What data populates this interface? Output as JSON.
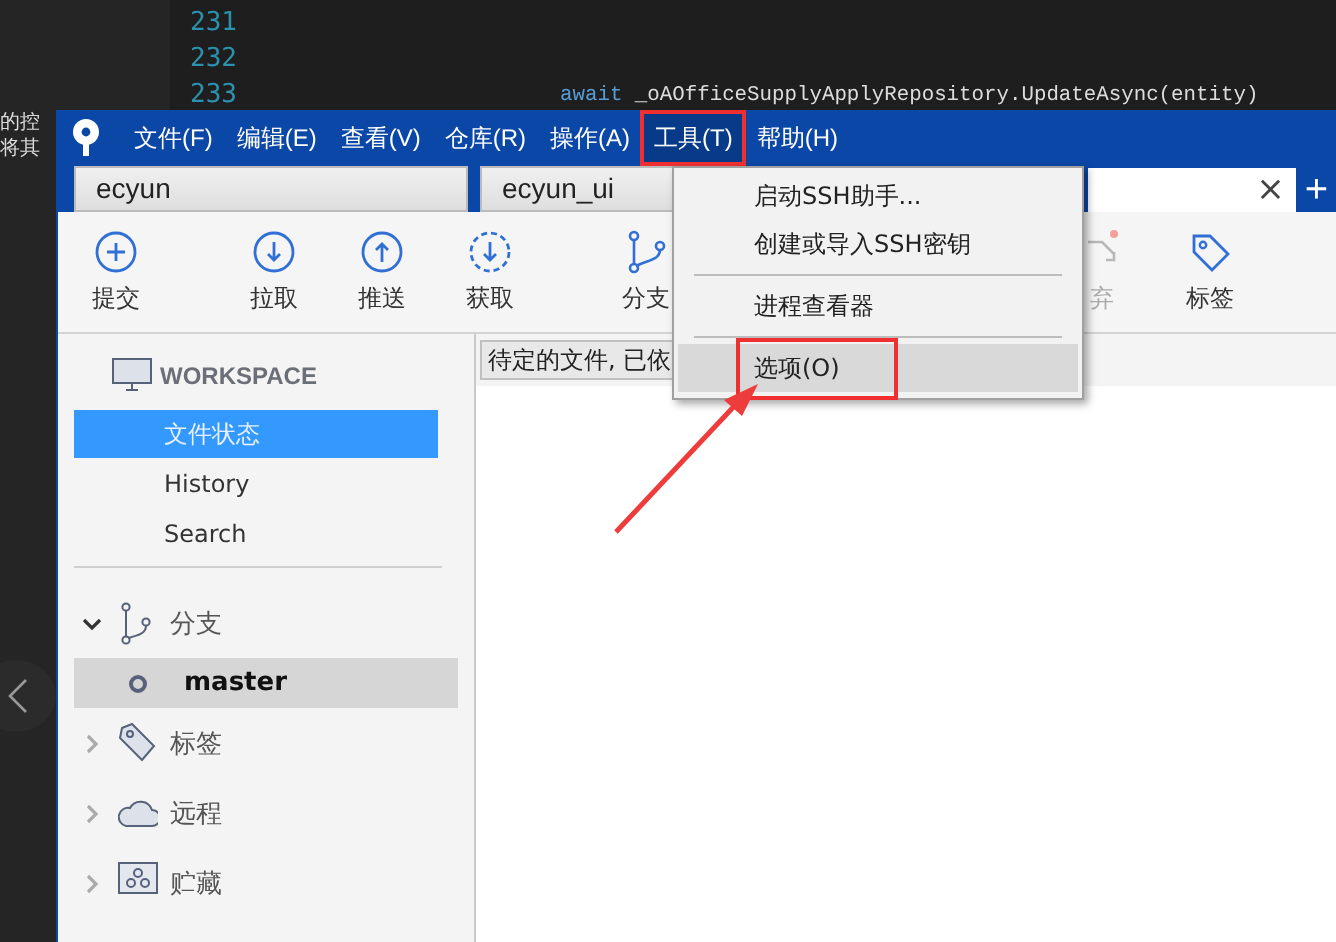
{
  "editor": {
    "side_texts": [
      "的控",
      "将其"
    ],
    "line_numbers": [
      "231",
      "232",
      "233"
    ],
    "code_line": {
      "keyword": "await",
      "rest": "_oAOfficeSupplyApplyRepository.UpdateAsync(entity)"
    }
  },
  "window": {
    "menu": [
      {
        "label": "文件(F)",
        "selected": false,
        "annotated": false
      },
      {
        "label": "编辑(E)",
        "selected": false,
        "annotated": false
      },
      {
        "label": "查看(V)",
        "selected": false,
        "annotated": false
      },
      {
        "label": "仓库(R)",
        "selected": false,
        "annotated": false
      },
      {
        "label": "操作(A)",
        "selected": false,
        "annotated": false
      },
      {
        "label": "工具(T)",
        "selected": true,
        "annotated": true
      },
      {
        "label": "帮助(H)",
        "selected": false,
        "annotated": false
      }
    ],
    "tabs": [
      {
        "label": "ecyun",
        "selected": false
      },
      {
        "label": "ecyun_ui",
        "selected": false
      }
    ],
    "tab_close": "×",
    "tab_add": "+",
    "toolbar": [
      {
        "label": "提交",
        "kind": "commit",
        "disabled": false
      },
      {
        "label": "拉取",
        "kind": "pull",
        "disabled": false
      },
      {
        "label": "推送",
        "kind": "push",
        "disabled": false
      },
      {
        "label": "获取",
        "kind": "fetch",
        "disabled": false
      },
      {
        "label": "分支",
        "kind": "branch",
        "disabled": false
      },
      {
        "label": "弃",
        "kind": "discard",
        "disabled": true
      },
      {
        "label": "标签",
        "kind": "tag",
        "disabled": false
      }
    ],
    "sidebar": {
      "workspace": "WORKSPACE",
      "items": [
        {
          "label": "文件状态",
          "selected": true
        },
        {
          "label": "History",
          "selected": false
        },
        {
          "label": "Search",
          "selected": false
        }
      ],
      "sections": [
        {
          "label": "分支",
          "kind": "branch",
          "expanded": true,
          "children": [
            {
              "label": "master",
              "selected": true
            }
          ]
        },
        {
          "label": "标签",
          "kind": "tag",
          "expanded": false
        },
        {
          "label": "远程",
          "kind": "remote",
          "expanded": false
        },
        {
          "label": "贮藏",
          "kind": "stash",
          "expanded": false
        }
      ]
    },
    "filter": "待定的文件, 已依",
    "dropdown": [
      {
        "kind": "item",
        "label": "启动SSH助手...",
        "selected": false,
        "annotated": false
      },
      {
        "kind": "item",
        "label": "创建或导入SSH密钥",
        "selected": false,
        "annotated": false
      },
      {
        "kind": "separator"
      },
      {
        "kind": "item",
        "label": "进程查看器",
        "selected": false,
        "annotated": false
      },
      {
        "kind": "separator"
      },
      {
        "kind": "item",
        "label": "选项(O)",
        "selected": true,
        "annotated": true
      }
    ]
  }
}
